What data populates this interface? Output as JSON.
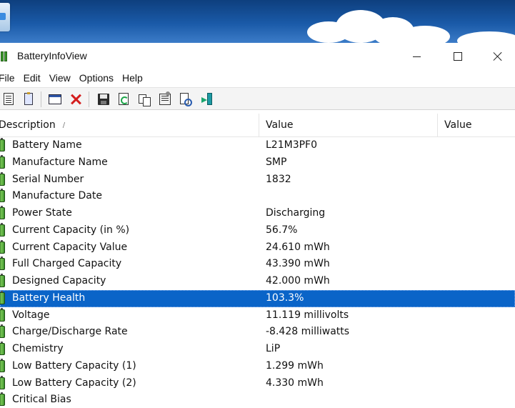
{
  "window": {
    "title": "BatteryInfoView"
  },
  "menu": [
    "File",
    "Edit",
    "View",
    "Options",
    "Help"
  ],
  "toolbar": {
    "buttons": [
      {
        "name": "view-battery-info-icon"
      },
      {
        "name": "view-log-icon"
      },
      {
        "name": "window-icon"
      },
      {
        "name": "delete-icon"
      },
      {
        "name": "save-icon"
      },
      {
        "name": "refresh-icon"
      },
      {
        "name": "copy-icon"
      },
      {
        "name": "properties-icon"
      },
      {
        "name": "find-icon"
      },
      {
        "name": "exit-icon"
      }
    ]
  },
  "list": {
    "columns": [
      "Description",
      "Value",
      "Value"
    ],
    "sort_indicator": "/",
    "rows": [
      {
        "description": "Battery Name",
        "value": "L21M3PF0"
      },
      {
        "description": "Manufacture Name",
        "value": "SMP"
      },
      {
        "description": "Serial Number",
        "value": "1832"
      },
      {
        "description": "Manufacture Date",
        "value": ""
      },
      {
        "description": "Power State",
        "value": "Discharging"
      },
      {
        "description": "Current Capacity (in %)",
        "value": "56.7%"
      },
      {
        "description": "Current Capacity Value",
        "value": "24.610 mWh"
      },
      {
        "description": "Full Charged Capacity",
        "value": "43.390 mWh"
      },
      {
        "description": "Designed Capacity",
        "value": "42.000 mWh"
      },
      {
        "description": "Battery Health",
        "value": "103.3%",
        "selected": true
      },
      {
        "description": "Voltage",
        "value": "11.119 millivolts"
      },
      {
        "description": "Charge/Discharge Rate",
        "value": "-8.428 milliwatts"
      },
      {
        "description": "Chemistry",
        "value": "LiP"
      },
      {
        "description": "Low Battery Capacity (1)",
        "value": "1.299 mWh"
      },
      {
        "description": "Low Battery Capacity (2)",
        "value": "4.330 mWh"
      },
      {
        "description": "Critical Bias",
        "value": ""
      }
    ]
  },
  "colors": {
    "selection": "#0a64c8",
    "battery_icon": "#3c9a2c"
  }
}
